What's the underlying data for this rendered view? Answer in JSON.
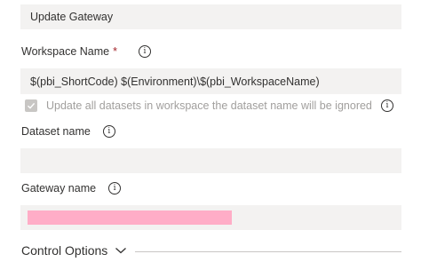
{
  "display_name": {
    "value": "Update Gateway"
  },
  "workspace_name": {
    "label": "Workspace Name",
    "required_marker": "*",
    "value": "$(pbi_ShortCode) $(Environment)\\$(pbi_WorkspaceName)"
  },
  "update_all_datasets": {
    "label": "Update all datasets in workspace the dataset name will be ignored",
    "checked": true,
    "disabled": true
  },
  "dataset_name": {
    "label": "Dataset name",
    "value": ""
  },
  "gateway_name": {
    "label": "Gateway name",
    "value": "",
    "redacted": true,
    "redaction_color": "#ffadc7"
  },
  "control_options": {
    "label": "Control Options"
  },
  "icons": {
    "info": "info-icon",
    "checkmark": "checkmark-icon",
    "chevron": "chevron-down-icon"
  },
  "colors": {
    "field_bg": "#f3f2f1",
    "text": "#323130",
    "disabled_text": "#a19f9d",
    "required": "#a4262c"
  }
}
